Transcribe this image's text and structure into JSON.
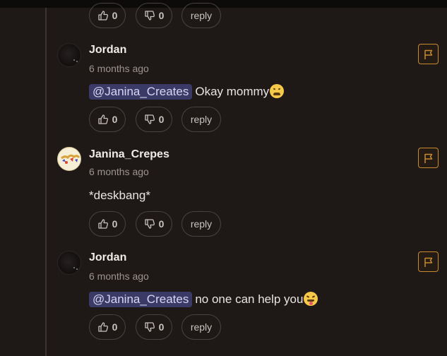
{
  "ui": {
    "reply_label": "reply",
    "colors": {
      "background": "#1e1917",
      "mention_bg": "#3a3a66",
      "flag_accent": "#c88a2d"
    }
  },
  "partial_top": {
    "likes": "0",
    "dislikes": "0",
    "reply": "reply"
  },
  "comments": [
    {
      "author": "Jordan",
      "timestamp": "6 months ago",
      "mention": "@Janina_Creates",
      "text": "Okay mommy",
      "emoji": "weary-face-emoji",
      "likes": "0",
      "dislikes": "0",
      "reply": "reply"
    },
    {
      "author": "Janina_Crepes",
      "timestamp": "6 months ago",
      "mention": "",
      "text": "*deskbang*",
      "emoji": "",
      "likes": "0",
      "dislikes": "0",
      "reply": "reply"
    },
    {
      "author": "Jordan",
      "timestamp": "6 months ago",
      "mention": "@Janina_Creates",
      "text": "no one can help you",
      "emoji": "tongue-out-emoji",
      "likes": "0",
      "dislikes": "0",
      "reply": "reply"
    }
  ]
}
